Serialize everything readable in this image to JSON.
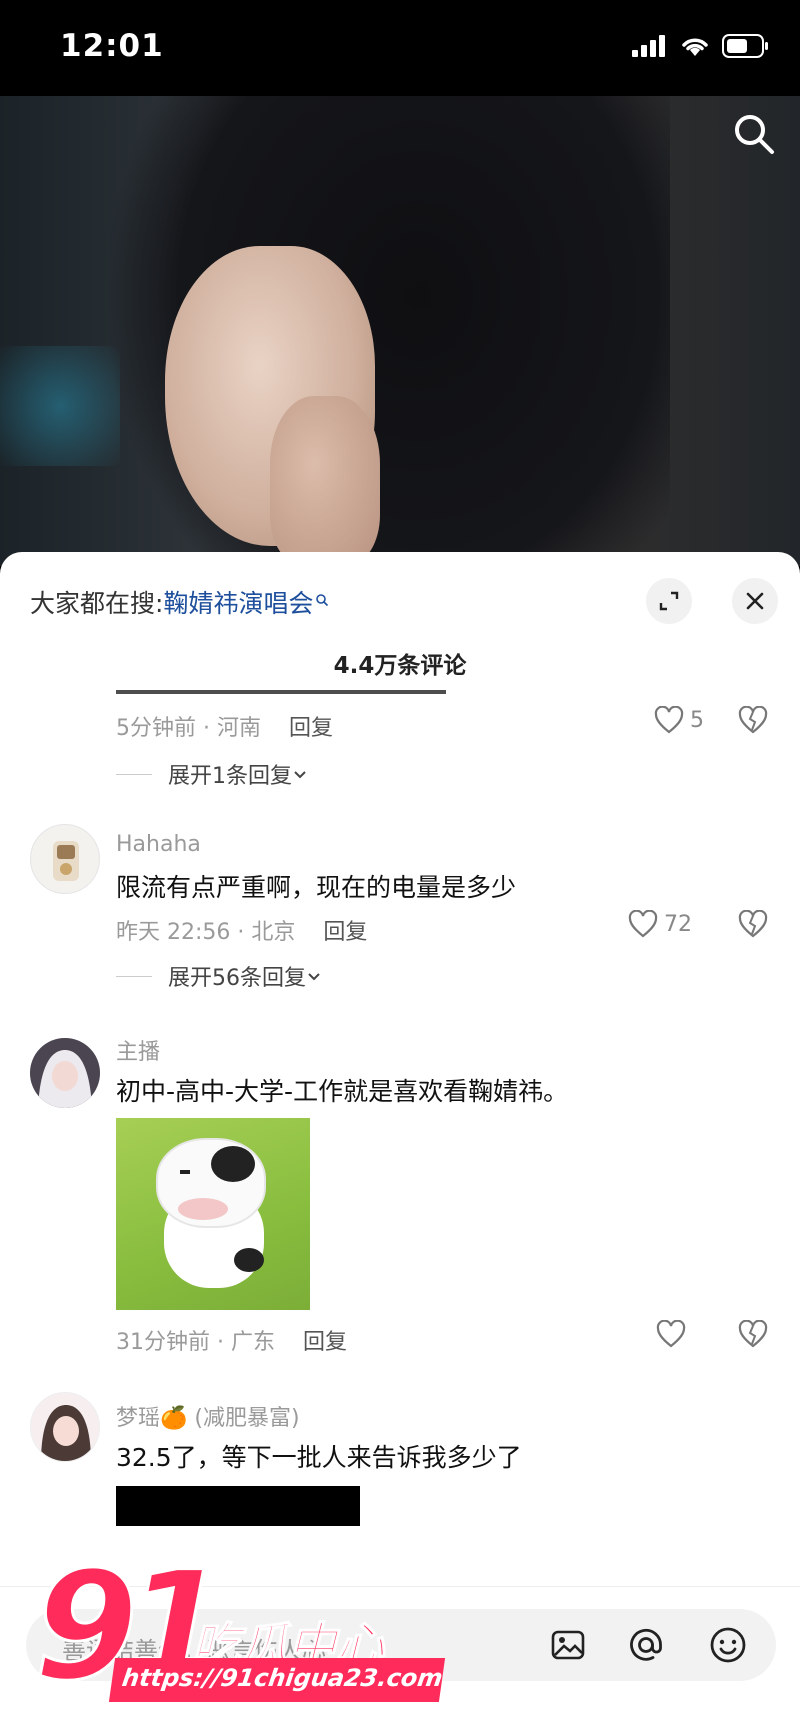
{
  "status_bar": {
    "time": "12:01"
  },
  "sheet": {
    "hot_search_prefix": "大家都在搜:",
    "hot_search_keyword": "鞠婧祎演唱会",
    "comment_count": "4.4万条评论"
  },
  "comments": [
    {
      "username": "",
      "text": "",
      "time_location": "5分钟前 · 河南",
      "reply_label": "回复",
      "likes": "5",
      "expand_label": "展开1条回复"
    },
    {
      "username": "Hahaha",
      "text": "限流有点严重啊，现在的电量是多少",
      "time_location": "昨天 22:56 · 北京",
      "reply_label": "回复",
      "likes": "72",
      "expand_label": "展开56条回复"
    },
    {
      "username": "主播",
      "text": "初中-高中-大学-工作就是喜欢看鞠婧祎。",
      "time_location": "31分钟前 · 广东",
      "reply_label": "回复",
      "likes": ""
    },
    {
      "username": "梦瑶🍊 (减肥暴富)",
      "text": "32.5了，等下一批人来告诉我多少了"
    }
  ],
  "input_bar": {
    "placeholder": "善语结善缘，恶言伤人心"
  },
  "watermark": {
    "number": "91",
    "brand": "吃瓜中心",
    "url": "https://91chigua23.com"
  },
  "colors": {
    "accent_link": "#1d4f9c",
    "watermark": "#ff2b5a"
  }
}
